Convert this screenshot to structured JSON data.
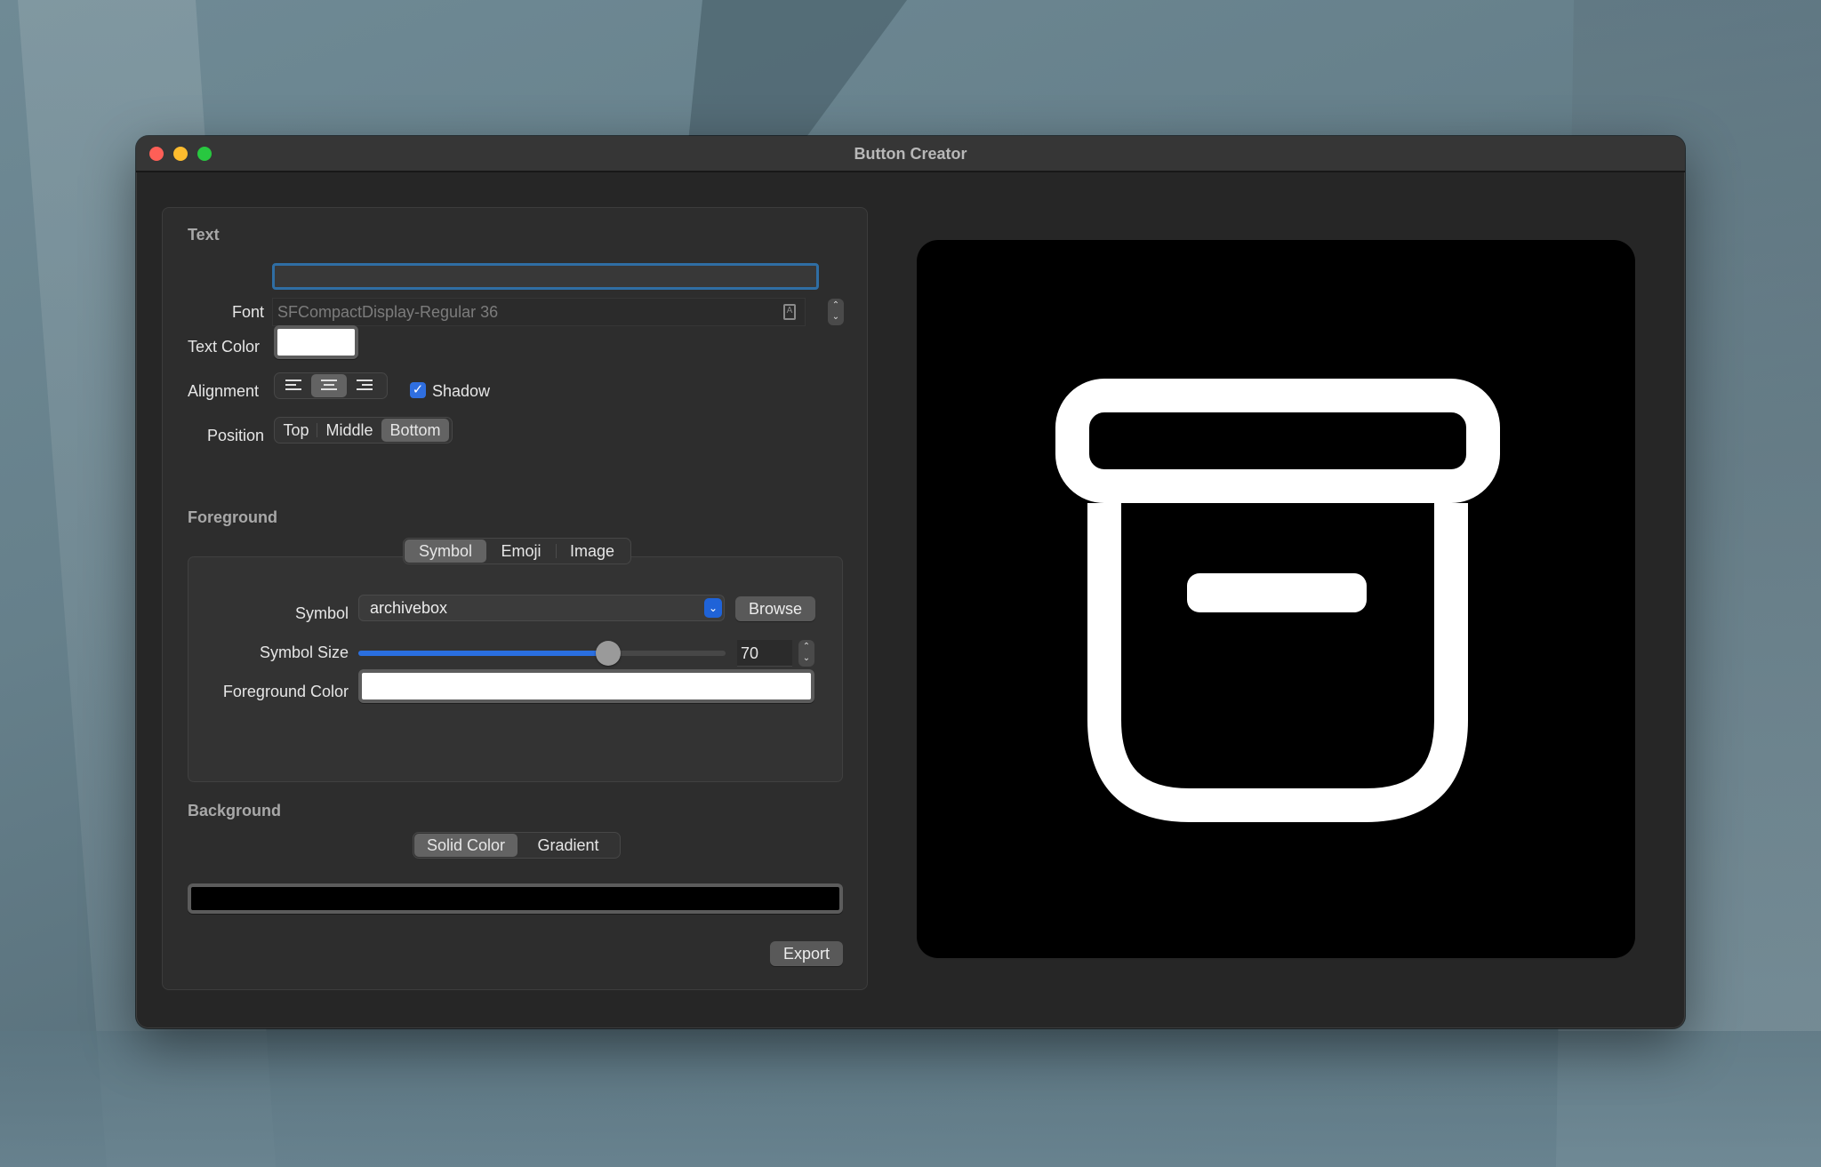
{
  "window": {
    "title": "Button Creator"
  },
  "text_section": {
    "heading": "Text",
    "text_value": "",
    "font_label": "Font",
    "font_value": "SFCompactDisplay-Regular 36",
    "text_color_label": "Text Color",
    "text_color": "#ffffff",
    "alignment_label": "Alignment",
    "alignment_options": [
      "left",
      "center",
      "right"
    ],
    "alignment_selected": "center",
    "shadow_label": "Shadow",
    "shadow_checked": true,
    "position_label": "Position",
    "position_options": [
      "Top",
      "Middle",
      "Bottom"
    ],
    "position_selected": "Bottom"
  },
  "foreground_section": {
    "heading": "Foreground",
    "tabs": [
      "Symbol",
      "Emoji",
      "Image"
    ],
    "tab_selected": "Symbol",
    "symbol_label": "Symbol",
    "symbol_value": "archivebox",
    "browse_label": "Browse",
    "symbol_size_label": "Symbol Size",
    "symbol_size_value": "70",
    "symbol_size_slider_fraction": 0.68,
    "foreground_color_label": "Foreground Color",
    "foreground_color": "#ffffff"
  },
  "background_section": {
    "heading": "Background",
    "tabs": [
      "Solid Color",
      "Gradient"
    ],
    "tab_selected": "Solid Color",
    "background_color": "#000000"
  },
  "export_label": "Export",
  "preview": {
    "symbol": "archivebox-icon",
    "background_color": "#000000",
    "foreground_color": "#ffffff"
  },
  "icons": {
    "close": "close-button",
    "minimize": "minimize-button",
    "zoom": "zoom-button",
    "font_panel": "font-book-icon",
    "stepper_up": "▲",
    "stepper_down": "▼",
    "popup_chevron": "⌄",
    "checkmark": "✓"
  },
  "accent_color": "#2a6fe0"
}
